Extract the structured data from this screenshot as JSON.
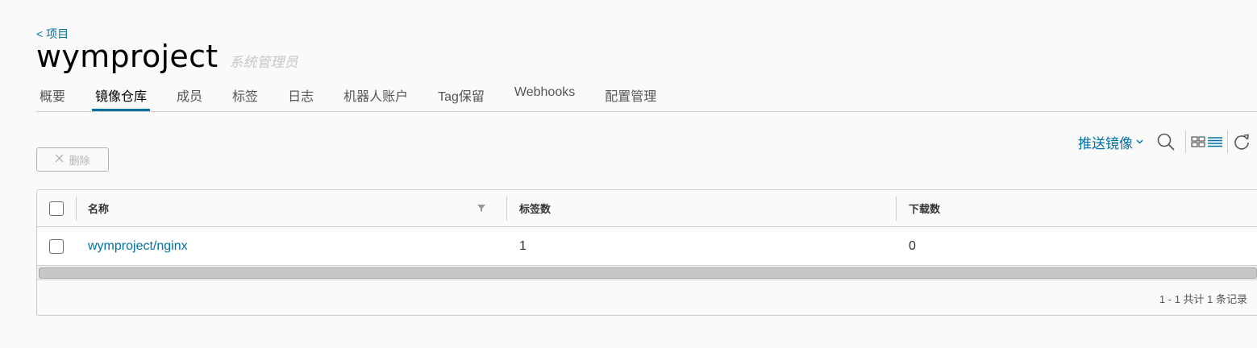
{
  "breadcrumb": {
    "back_label": "< 项目"
  },
  "header": {
    "title": "wymproject",
    "role": "系统管理员"
  },
  "tabs": [
    {
      "label": "概要",
      "active": false
    },
    {
      "label": "镜像仓库",
      "active": true
    },
    {
      "label": "成员",
      "active": false
    },
    {
      "label": "标签",
      "active": false
    },
    {
      "label": "日志",
      "active": false
    },
    {
      "label": "机器人账户",
      "active": false
    },
    {
      "label": "Tag保留",
      "active": false
    },
    {
      "label": "Webhooks",
      "active": false
    },
    {
      "label": "配置管理",
      "active": false
    }
  ],
  "toolbar": {
    "push_label": "推送镜像",
    "delete_label": "删除",
    "icons": [
      "search-icon",
      "card-view-icon",
      "list-view-icon",
      "refresh-icon"
    ]
  },
  "table": {
    "columns": [
      "名称",
      "标签数",
      "下载数"
    ],
    "rows": [
      {
        "name": "wymproject/nginx",
        "tags": "1",
        "downloads": "0"
      }
    ],
    "footer": "1 - 1 共计 1 条记录"
  },
  "colors": {
    "accent": "#0072a3",
    "border": "#cccccc",
    "background": "#fafafa"
  }
}
